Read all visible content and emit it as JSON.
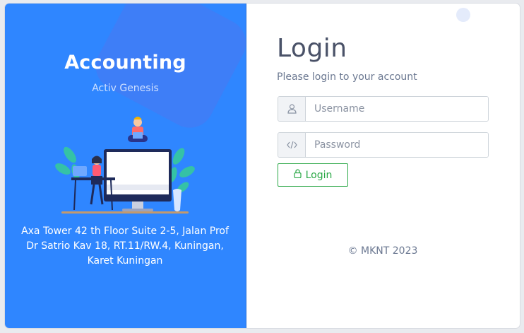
{
  "brand": {
    "title": "Accounting",
    "subtitle": "Activ Genesis"
  },
  "address": "Axa Tower 42 th Floor Suite 2-5, Jalan Prof Dr Satrio Kav 18, RT.11/RW.4, Kuningan, Karet Kuningan",
  "login": {
    "title": "Login",
    "hint": "Please login to your account",
    "username_placeholder": "Username",
    "password_placeholder": "Password",
    "button_label": "Login"
  },
  "footer": {
    "copyright": "© MKNT 2023"
  },
  "colors": {
    "panel": "#2f86ff",
    "accent_green": "#29a745",
    "title": "#4a5268"
  },
  "icons": {
    "username": "user-icon",
    "password": "code-icon",
    "login": "lock-icon"
  }
}
